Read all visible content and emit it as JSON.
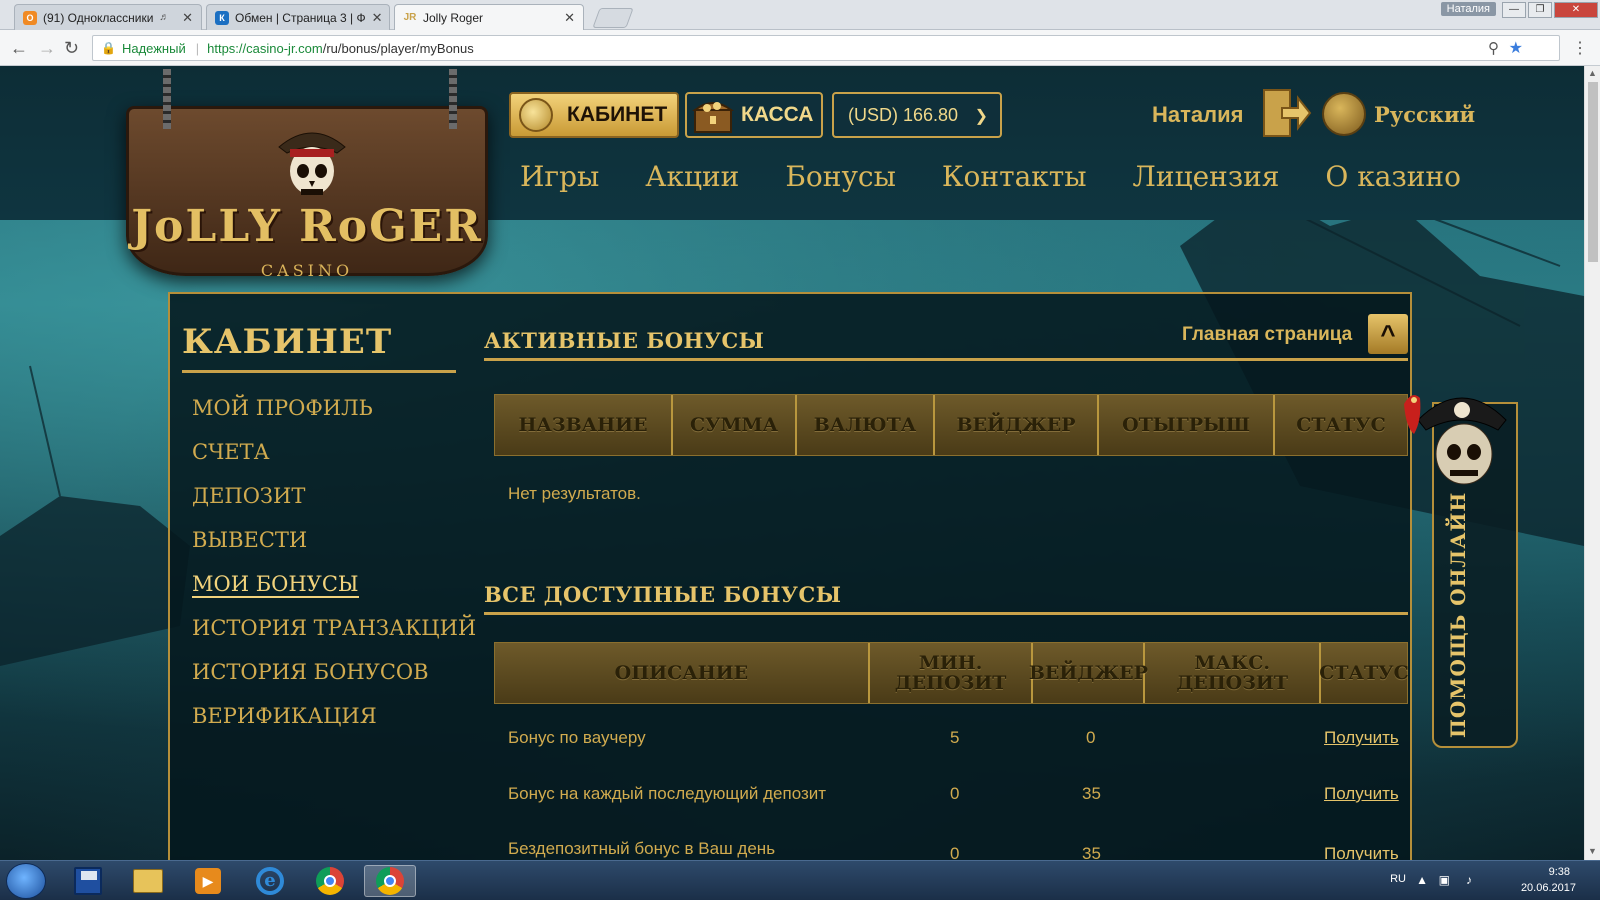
{
  "browser": {
    "tabs": [
      {
        "title": "(91) Одноклассники",
        "favicon_color": "#f08a24"
      },
      {
        "title": "Обмен | Страница 3 | Ф",
        "favicon_color": "#1b6fc2"
      },
      {
        "title": "Jolly Roger",
        "favicon_color": "#c9a24a"
      }
    ],
    "window_user": "Наталия",
    "secure_label": "Надежный",
    "url_host": "https://casino-jr.com",
    "url_path": "/ru/bonus/player/myBonus"
  },
  "logo": {
    "title": "JoLLY RoGER",
    "subtitle": "CASINO"
  },
  "header": {
    "cabinet_label": "КАБИНЕТ",
    "kassa_label": "КАССА",
    "balance": "(USD) 166.80",
    "username": "Наталия",
    "language": "Русский"
  },
  "nav": [
    "Игры",
    "Акции",
    "Бонусы",
    "Контакты",
    "Лицензия",
    "О казино"
  ],
  "sidebar": {
    "title": "КАБИНЕТ",
    "items": [
      {
        "label": "МОЙ ПРОФИЛЬ"
      },
      {
        "label": "СЧЕТА"
      },
      {
        "label": "ДЕПОЗИТ"
      },
      {
        "label": "ВЫВЕСТИ"
      },
      {
        "label": "МОИ БОНУСЫ"
      },
      {
        "label": "ИСТОРИЯ ТРАНЗАКЦИЙ"
      },
      {
        "label": "ИСТОРИЯ БОНУСОВ"
      },
      {
        "label": "ВЕРИФИКАЦИЯ"
      }
    ]
  },
  "active_bonuses": {
    "title": "АКТИВНЫЕ БОНУСЫ",
    "home_link": "Главная страница",
    "columns": [
      "НАЗВАНИЕ",
      "СУММА",
      "ВАЛЮТА",
      "ВЕЙДЖЕР",
      "ОТЫГРЫШ",
      "СТАТУС"
    ],
    "empty_text": "Нет результатов."
  },
  "available_bonuses": {
    "title": "ВСЕ ДОСТУПНЫЕ БОНУСЫ",
    "columns": [
      "ОПИСАНИЕ",
      "МИН. ДЕПОЗИТ",
      "ВЕЙДЖЕР",
      "МАКС. ДЕПОЗИТ",
      "СТАТУС"
    ],
    "rows": [
      {
        "description": "Бонус по ваучеру",
        "min_deposit": "5",
        "wager": "0",
        "max_deposit": "",
        "status": "Получить"
      },
      {
        "description": "Бонус на каждый последующий депозит",
        "min_deposit": "0",
        "wager": "35",
        "max_deposit": "",
        "status": "Получить"
      },
      {
        "description": "Бездепозитный бонус в Ваш день рождения",
        "min_deposit": "0",
        "wager": "35",
        "max_deposit": "",
        "status": "Получить"
      }
    ]
  },
  "help_widget": {
    "label": "ПОМОЩЬ ОНЛАЙН"
  },
  "taskbar": {
    "language": "RU",
    "time": "9:38",
    "date": "20.06.2017"
  },
  "colors": {
    "gold": "#d9b65b",
    "panel_bg": "#04181e",
    "accent": "#c9a24a"
  }
}
